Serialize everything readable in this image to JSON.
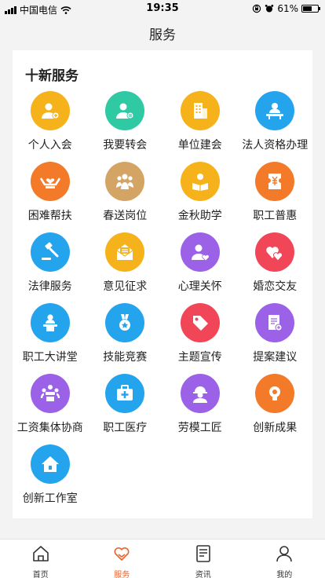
{
  "status_bar": {
    "carrier": "中国电信",
    "time": "19:35",
    "battery": "61%",
    "battery_level": 0.61
  },
  "nav": {
    "title": "服务"
  },
  "section": {
    "title": "十新服务"
  },
  "services": [
    {
      "label": "个人入会",
      "icon": "person-add-icon",
      "color": "#f6b21b"
    },
    {
      "label": "我要转会",
      "icon": "person-transfer-icon",
      "color": "#2fc9a3"
    },
    {
      "label": "单位建会",
      "icon": "building-icon",
      "color": "#f6b21b"
    },
    {
      "label": "法人资格办理",
      "icon": "desk-person-icon",
      "color": "#25a4ee"
    },
    {
      "label": "困难帮扶",
      "icon": "helping-hands-icon",
      "color": "#f27a28"
    },
    {
      "label": "春送岗位",
      "icon": "group-icon",
      "color": "#d4a465"
    },
    {
      "label": "金秋助学",
      "icon": "student-reading-icon",
      "color": "#f6b21b"
    },
    {
      "label": "职工普惠",
      "icon": "coupon-yuan-icon",
      "color": "#f27a28"
    },
    {
      "label": "法律服务",
      "icon": "gavel-icon",
      "color": "#25a4ee"
    },
    {
      "label": "意见征求",
      "icon": "envelope-icon",
      "color": "#f6b21b"
    },
    {
      "label": "心理关怀",
      "icon": "person-heart-icon",
      "color": "#9b62e8"
    },
    {
      "label": "婚恋交友",
      "icon": "hearts-icon",
      "color": "#f04658"
    },
    {
      "label": "职工大讲堂",
      "icon": "lecturer-icon",
      "color": "#25a4ee"
    },
    {
      "label": "技能竞赛",
      "icon": "medal-icon",
      "color": "#25a4ee"
    },
    {
      "label": "主题宣传",
      "icon": "tag-icon",
      "color": "#f04658"
    },
    {
      "label": "提案建议",
      "icon": "document-icon",
      "color": "#9b62e8"
    },
    {
      "label": "工资集体协商",
      "icon": "meeting-icon",
      "color": "#9b62e8"
    },
    {
      "label": "职工医疗",
      "icon": "medical-kit-icon",
      "color": "#25a4ee"
    },
    {
      "label": "劳模工匠",
      "icon": "worker-helmet-icon",
      "color": "#9b62e8"
    },
    {
      "label": "创新成果",
      "icon": "lightbulb-icon",
      "color": "#f27a28"
    },
    {
      "label": "创新工作室",
      "icon": "house-icon",
      "color": "#25a4ee"
    }
  ],
  "tabs": [
    {
      "label": "首页",
      "icon": "home-icon",
      "active": false
    },
    {
      "label": "服务",
      "icon": "service-heart-icon",
      "active": true
    },
    {
      "label": "资讯",
      "icon": "news-icon",
      "active": false
    },
    {
      "label": "我的",
      "icon": "profile-icon",
      "active": false
    }
  ],
  "colors": {
    "accent": "#e8622a",
    "tab_inactive": "#333333"
  }
}
